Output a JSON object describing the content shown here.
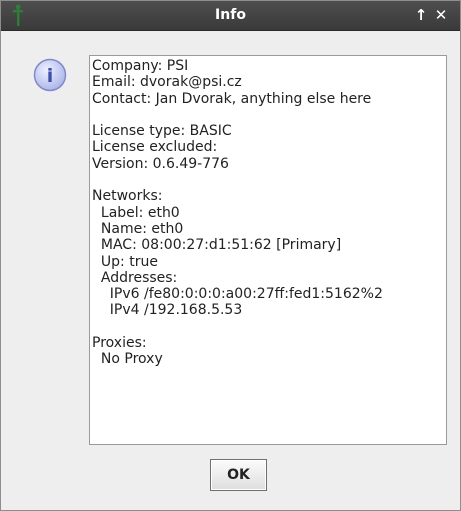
{
  "window": {
    "title": "Info",
    "maximize_glyph": "↑",
    "close_glyph": "✕"
  },
  "icons": {
    "app_icon": "app-icon",
    "info_icon": "info-icon",
    "info_glyph": "i"
  },
  "colors": {
    "titlebar": "#444444",
    "app_icon_green": "#2f7d3a",
    "info_circle": "#bcc4ef",
    "info_glyph": "#3c4fa8"
  },
  "info": {
    "lines": [
      "Company: PSI",
      "Email: dvorak@psi.cz",
      "Contact: Jan Dvorak, anything else here",
      "",
      "License type: BASIC",
      "License excluded:",
      "Version: 0.6.49-776",
      "",
      "Networks:",
      "  Label: eth0",
      "  Name: eth0",
      "  MAC: 08:00:27:d1:51:62 [Primary]",
      "  Up: true",
      "  Addresses:",
      "    IPv6 /fe80:0:0:0:a00:27ff:fed1:5162%2",
      "    IPv4 /192.168.5.53",
      "",
      "Proxies:",
      "  No Proxy"
    ]
  },
  "buttons": {
    "ok_label": "OK"
  }
}
